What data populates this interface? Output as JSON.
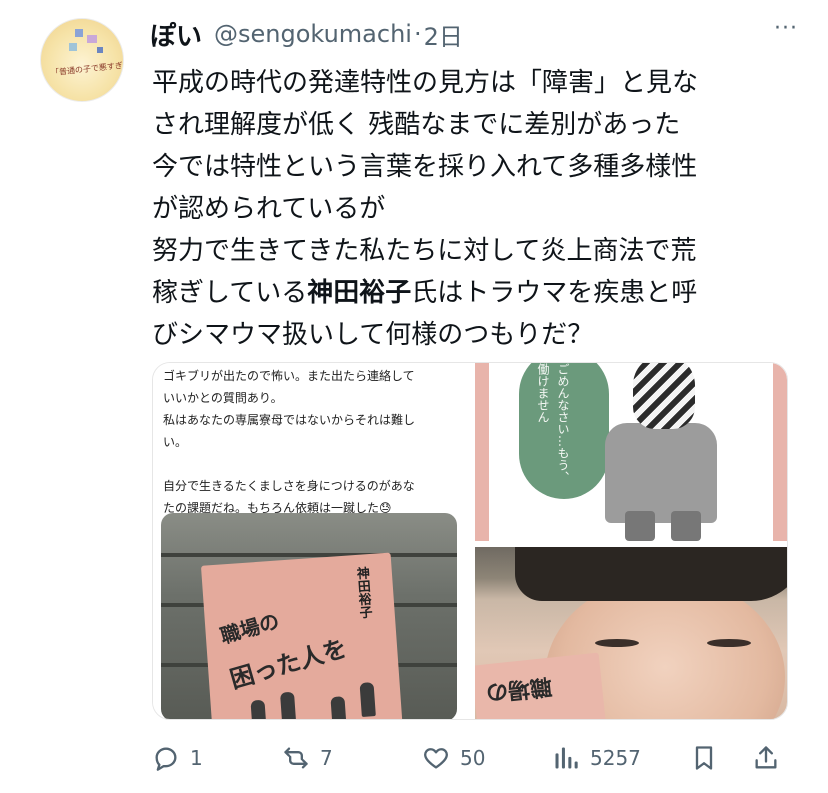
{
  "post": {
    "display_name": "ぽい",
    "handle": "@sengokumachi",
    "separator": "·",
    "time": "2日",
    "more_label": "···",
    "avatar_caption": "「普通の子で悪すぎ」",
    "text_lines": [
      "平成の時代の発達特性の見方は「障害」と見な",
      "され理解度が低く 残酷なまでに差別があった",
      "今では特性という言葉を採り入れて多種多様性",
      "が認められているが",
      "努力で生きてきた私たちに対して炎上商法で荒"
    ],
    "line6_pre": "稼ぎしている",
    "line6_bold": "神田裕子",
    "line6_post": "氏はトラウマを疾患と呼",
    "line7": "びシマウマ扱いして何様のつもりだ？"
  },
  "media": {
    "panel1_text_lines": [
      "ゴキブリが出たので怖い。また出たら連絡して",
      "いいかとの質問あり。",
      "私はあなたの専属寮母ではないからそれは難し",
      "い。",
      "",
      "自分で生きるたくましさを身につけるのがあな",
      "たの課題だね。もちろん依頼は一蹴した😓"
    ],
    "book_title_1": "職場の",
    "book_title_2": "困った人を",
    "book_author": "神田裕子",
    "bubble_text": "ごめんなさい…もう、働けません",
    "card_text": "職場の"
  },
  "actions": {
    "replies": "1",
    "reposts": "7",
    "likes": "50",
    "views": "5257"
  },
  "icons": {
    "reply": "reply-icon",
    "repost": "repost-icon",
    "like": "heart-icon",
    "views": "views-bar-chart-icon",
    "bookmark": "bookmark-icon",
    "share": "share-icon"
  },
  "colors": {
    "text": "#0f1419",
    "secondary": "#536471",
    "pink": "#e8b4ab",
    "green": "#6b9a7c"
  }
}
